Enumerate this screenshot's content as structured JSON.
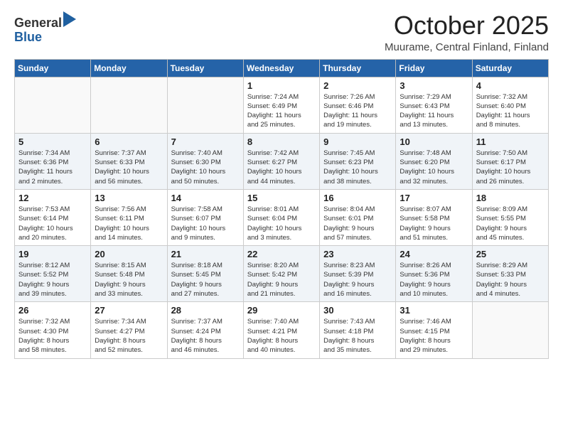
{
  "header": {
    "logo_line1": "General",
    "logo_line2": "Blue",
    "month": "October 2025",
    "location": "Muurame, Central Finland, Finland"
  },
  "weekdays": [
    "Sunday",
    "Monday",
    "Tuesday",
    "Wednesday",
    "Thursday",
    "Friday",
    "Saturday"
  ],
  "weeks": [
    [
      {
        "day": "",
        "info": ""
      },
      {
        "day": "",
        "info": ""
      },
      {
        "day": "",
        "info": ""
      },
      {
        "day": "1",
        "info": "Sunrise: 7:24 AM\nSunset: 6:49 PM\nDaylight: 11 hours\nand 25 minutes."
      },
      {
        "day": "2",
        "info": "Sunrise: 7:26 AM\nSunset: 6:46 PM\nDaylight: 11 hours\nand 19 minutes."
      },
      {
        "day": "3",
        "info": "Sunrise: 7:29 AM\nSunset: 6:43 PM\nDaylight: 11 hours\nand 13 minutes."
      },
      {
        "day": "4",
        "info": "Sunrise: 7:32 AM\nSunset: 6:40 PM\nDaylight: 11 hours\nand 8 minutes."
      }
    ],
    [
      {
        "day": "5",
        "info": "Sunrise: 7:34 AM\nSunset: 6:36 PM\nDaylight: 11 hours\nand 2 minutes."
      },
      {
        "day": "6",
        "info": "Sunrise: 7:37 AM\nSunset: 6:33 PM\nDaylight: 10 hours\nand 56 minutes."
      },
      {
        "day": "7",
        "info": "Sunrise: 7:40 AM\nSunset: 6:30 PM\nDaylight: 10 hours\nand 50 minutes."
      },
      {
        "day": "8",
        "info": "Sunrise: 7:42 AM\nSunset: 6:27 PM\nDaylight: 10 hours\nand 44 minutes."
      },
      {
        "day": "9",
        "info": "Sunrise: 7:45 AM\nSunset: 6:23 PM\nDaylight: 10 hours\nand 38 minutes."
      },
      {
        "day": "10",
        "info": "Sunrise: 7:48 AM\nSunset: 6:20 PM\nDaylight: 10 hours\nand 32 minutes."
      },
      {
        "day": "11",
        "info": "Sunrise: 7:50 AM\nSunset: 6:17 PM\nDaylight: 10 hours\nand 26 minutes."
      }
    ],
    [
      {
        "day": "12",
        "info": "Sunrise: 7:53 AM\nSunset: 6:14 PM\nDaylight: 10 hours\nand 20 minutes."
      },
      {
        "day": "13",
        "info": "Sunrise: 7:56 AM\nSunset: 6:11 PM\nDaylight: 10 hours\nand 14 minutes."
      },
      {
        "day": "14",
        "info": "Sunrise: 7:58 AM\nSunset: 6:07 PM\nDaylight: 10 hours\nand 9 minutes."
      },
      {
        "day": "15",
        "info": "Sunrise: 8:01 AM\nSunset: 6:04 PM\nDaylight: 10 hours\nand 3 minutes."
      },
      {
        "day": "16",
        "info": "Sunrise: 8:04 AM\nSunset: 6:01 PM\nDaylight: 9 hours\nand 57 minutes."
      },
      {
        "day": "17",
        "info": "Sunrise: 8:07 AM\nSunset: 5:58 PM\nDaylight: 9 hours\nand 51 minutes."
      },
      {
        "day": "18",
        "info": "Sunrise: 8:09 AM\nSunset: 5:55 PM\nDaylight: 9 hours\nand 45 minutes."
      }
    ],
    [
      {
        "day": "19",
        "info": "Sunrise: 8:12 AM\nSunset: 5:52 PM\nDaylight: 9 hours\nand 39 minutes."
      },
      {
        "day": "20",
        "info": "Sunrise: 8:15 AM\nSunset: 5:48 PM\nDaylight: 9 hours\nand 33 minutes."
      },
      {
        "day": "21",
        "info": "Sunrise: 8:18 AM\nSunset: 5:45 PM\nDaylight: 9 hours\nand 27 minutes."
      },
      {
        "day": "22",
        "info": "Sunrise: 8:20 AM\nSunset: 5:42 PM\nDaylight: 9 hours\nand 21 minutes."
      },
      {
        "day": "23",
        "info": "Sunrise: 8:23 AM\nSunset: 5:39 PM\nDaylight: 9 hours\nand 16 minutes."
      },
      {
        "day": "24",
        "info": "Sunrise: 8:26 AM\nSunset: 5:36 PM\nDaylight: 9 hours\nand 10 minutes."
      },
      {
        "day": "25",
        "info": "Sunrise: 8:29 AM\nSunset: 5:33 PM\nDaylight: 9 hours\nand 4 minutes."
      }
    ],
    [
      {
        "day": "26",
        "info": "Sunrise: 7:32 AM\nSunset: 4:30 PM\nDaylight: 8 hours\nand 58 minutes."
      },
      {
        "day": "27",
        "info": "Sunrise: 7:34 AM\nSunset: 4:27 PM\nDaylight: 8 hours\nand 52 minutes."
      },
      {
        "day": "28",
        "info": "Sunrise: 7:37 AM\nSunset: 4:24 PM\nDaylight: 8 hours\nand 46 minutes."
      },
      {
        "day": "29",
        "info": "Sunrise: 7:40 AM\nSunset: 4:21 PM\nDaylight: 8 hours\nand 40 minutes."
      },
      {
        "day": "30",
        "info": "Sunrise: 7:43 AM\nSunset: 4:18 PM\nDaylight: 8 hours\nand 35 minutes."
      },
      {
        "day": "31",
        "info": "Sunrise: 7:46 AM\nSunset: 4:15 PM\nDaylight: 8 hours\nand 29 minutes."
      },
      {
        "day": "",
        "info": ""
      }
    ]
  ]
}
